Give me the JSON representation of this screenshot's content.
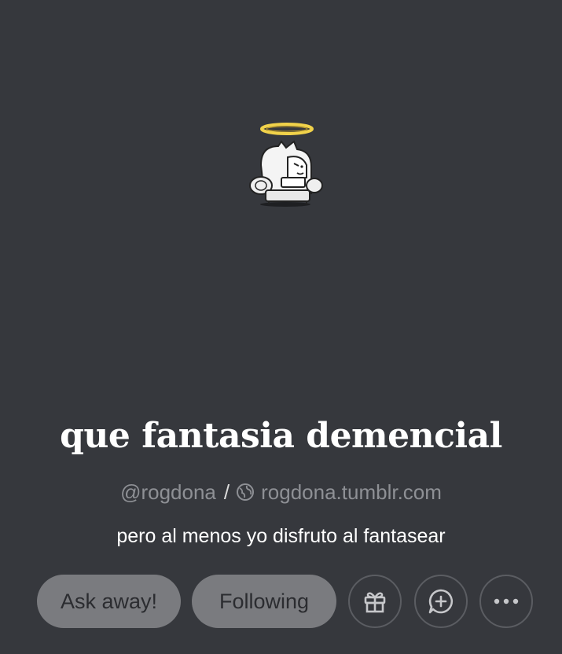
{
  "blog": {
    "title": "que fantasia demencial",
    "handle": "@rogdona",
    "separator": "/",
    "url": "rogdona.tumblr.com",
    "description": "pero al menos yo disfruto al fantasear"
  },
  "actions": {
    "ask_label": "Ask away!",
    "following_label": "Following",
    "gift_icon": "gift-icon",
    "chat_icon": "chat-plus-icon",
    "more_icon": "more-dots-icon"
  },
  "icons": {
    "globe": "globe-icon"
  },
  "colors": {
    "background": "#36383d",
    "button_fill": "#7a7b7f",
    "button_text": "#2b2c30",
    "muted_text": "#8e9095",
    "icon_stroke": "#c6c7ca",
    "halo": "#f1d24a"
  }
}
